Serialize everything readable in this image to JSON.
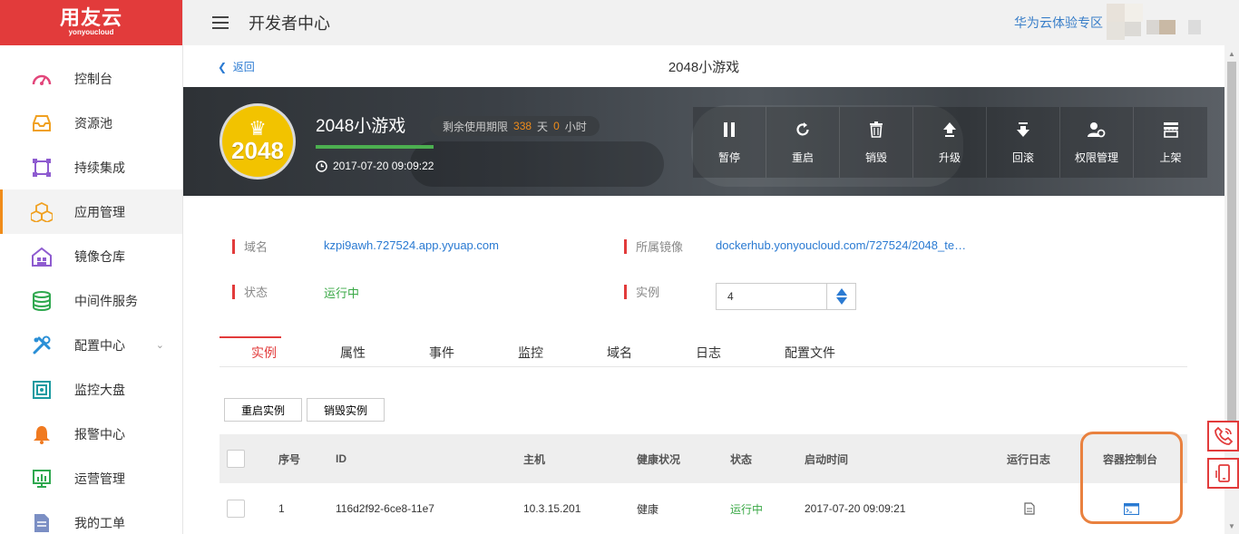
{
  "brand": {
    "name": "用友云",
    "sub": "yonyoucloud",
    "color": "#e23b3b"
  },
  "header": {
    "title": "开发者中心",
    "zone": "华为云体验专区"
  },
  "sidebar": {
    "items": [
      {
        "label": "控制台",
        "icon": "dashboard-icon"
      },
      {
        "label": "资源池",
        "icon": "inbox-icon"
      },
      {
        "label": "持续集成",
        "icon": "integration-icon"
      },
      {
        "label": "应用管理",
        "icon": "cubes-icon",
        "active": true
      },
      {
        "label": "镜像仓库",
        "icon": "warehouse-icon"
      },
      {
        "label": "中间件服务",
        "icon": "database-icon"
      },
      {
        "label": "配置中心",
        "icon": "tools-icon",
        "expandable": true
      },
      {
        "label": "监控大盘",
        "icon": "monitor-icon"
      },
      {
        "label": "报警中心",
        "icon": "bell-icon"
      },
      {
        "label": "运营管理",
        "icon": "chart-icon"
      },
      {
        "label": "我的工单",
        "icon": "document-icon"
      }
    ]
  },
  "page": {
    "back": "返回",
    "title": "2048小游戏"
  },
  "app": {
    "icon_text": "2048",
    "name": "2048小游戏",
    "quota_label": "剩余使用期限",
    "days": "338",
    "days_unit": "天",
    "hours": "0",
    "hours_unit": "小时",
    "created": "2017-07-20 09:09:22"
  },
  "actions": [
    "暂停",
    "重启",
    "销毁",
    "升级",
    "回滚",
    "权限管理",
    "上架"
  ],
  "info": {
    "domain_label": "域名",
    "domain": "kzpi9awh.727524.app.yyuap.com",
    "image_label": "所属镜像",
    "image": "dockerhub.yonyoucloud.com/727524/2048_te…",
    "status_label": "状态",
    "status": "运行中",
    "instances_label": "实例",
    "instances": "4"
  },
  "tabs": [
    "实例",
    "属性",
    "事件",
    "监控",
    "域名",
    "日志",
    "配置文件"
  ],
  "buttons": {
    "restart": "重启实例",
    "destroy": "销毁实例"
  },
  "table": {
    "headers": [
      "序号",
      "ID",
      "主机",
      "健康状况",
      "状态",
      "启动时间",
      "运行日志",
      "容器控制台"
    ],
    "rows": [
      {
        "index": "1",
        "id": "116d2f92-6ce8-11e7",
        "host": "10.3.15.201",
        "health": "健康",
        "status": "运行中",
        "start": "2017-07-20 09:09:21"
      }
    ]
  }
}
